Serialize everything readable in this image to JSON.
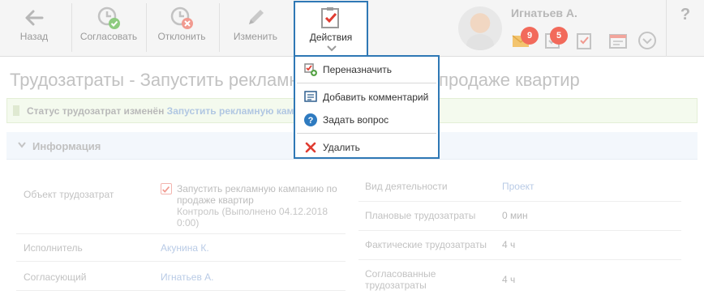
{
  "toolbar": {
    "back": "Назад",
    "approve": "Согласовать",
    "reject": "Отклонить",
    "edit": "Изменить",
    "actions": "Действия"
  },
  "user": {
    "name": "Игнатьев А.",
    "mail_count": "9",
    "tasks_count": "5"
  },
  "help": "?",
  "page": {
    "title": "Трудозатраты - Запустить рекламную кампанию по продаже квартир"
  },
  "status": {
    "prefix": "Статус трудозатрат изменён",
    "link": "Запустить рекламную кампанию по продаже квартир"
  },
  "section": {
    "title": "Информация"
  },
  "fields_left": {
    "object_label": "Объект трудозатрат",
    "object_title": "Запустить рекламную кампанию по продаже квартир",
    "object_sub": "Контроль (Выполнено 04.12.2018 0:00)",
    "executor_label": "Исполнитель",
    "executor_value": "Акунина К.",
    "approver_label": "Согласующий",
    "approver_value": "Игнатьев А."
  },
  "fields_right": {
    "activity_label": "Вид деятельности",
    "activity_value": "Проект",
    "planned_label": "Плановые трудозатраты",
    "planned_value": "0 мин",
    "actual_label": "Фактические трудозатраты",
    "actual_value": "4 ч",
    "agreed_label": "Согласованные трудозатраты",
    "agreed_value": "4 ч"
  },
  "menu": {
    "reassign": "Переназначить",
    "add_comment": "Добавить комментарий",
    "ask_question": "Задать вопрос",
    "delete": "Удалить"
  },
  "colors": {
    "accent_border": "#2f78b5",
    "badge": "#f26a5b",
    "delete_red": "#e03c31",
    "question_blue": "#2f7bc0"
  }
}
